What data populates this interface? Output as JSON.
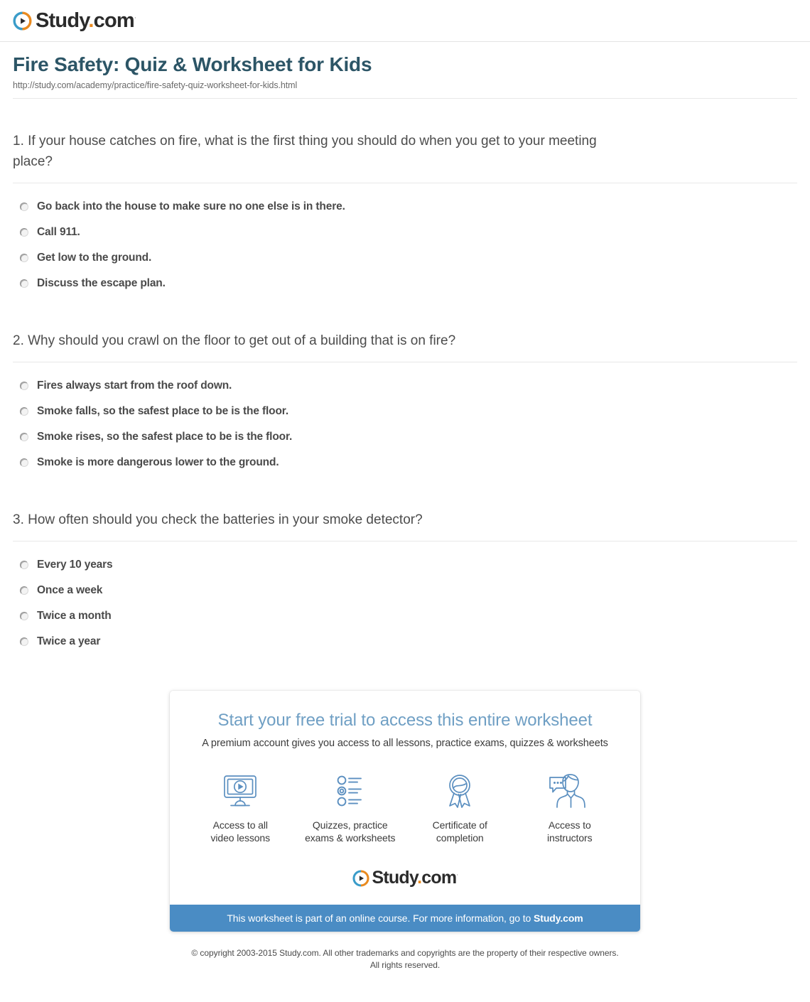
{
  "brand": {
    "name_main": "Study",
    "name_dot": ".",
    "name_tld": "com",
    "trademark": "·",
    "logo_icon": "play-circle-logo-icon",
    "colors": {
      "blue": "#3a9cc9",
      "orange": "#e98a1f",
      "word": "#2b2b2b"
    }
  },
  "header": {
    "title": "Fire Safety: Quiz & Worksheet for Kids",
    "url": "http://study.com/academy/practice/fire-safety-quiz-worksheet-for-kids.html"
  },
  "questions": [
    {
      "text": "1. If your house catches on fire, what is the first thing you should do when you get to your meeting place?",
      "options": [
        "Go back into the house to make sure no one else is in there.",
        "Call 911.",
        "Get low to the ground.",
        "Discuss the escape plan."
      ]
    },
    {
      "text": "2. Why should you crawl on the floor to get out of a building that is on fire?",
      "options": [
        "Fires always start from the roof down.",
        "Smoke falls, so the safest place to be is the floor.",
        "Smoke rises, so the safest place to be is the floor.",
        "Smoke is more dangerous lower to the ground."
      ]
    },
    {
      "text": "3. How often should you check the batteries in your smoke detector?",
      "options": [
        "Every 10 years",
        "Once a week",
        "Twice a month",
        "Twice a year"
      ]
    }
  ],
  "promo": {
    "headline": "Start your free trial to access this entire worksheet",
    "subhead": "A premium account gives you access to all lessons, practice exams, quizzes & worksheets",
    "features": [
      {
        "icon": "monitor-play-icon",
        "label": "Access to all\nvideo lessons",
        "line1": "Access to all",
        "line2": "video lessons"
      },
      {
        "icon": "checklist-icon",
        "label": "Quizzes, practice\nexams & worksheets",
        "line1": "Quizzes, practice",
        "line2": "exams & worksheets"
      },
      {
        "icon": "award-ribbon-icon",
        "label": "Certificate of\ncompletion",
        "line1": "Certificate of",
        "line2": "completion"
      },
      {
        "icon": "instructor-chat-icon",
        "label": "Access to\ninstructors",
        "line1": "Access to",
        "line2": "instructors"
      }
    ],
    "banner_text_before": "This worksheet is part of an online course. For more information, go to ",
    "banner_link": "Study.com",
    "banner_color": "#4a8cc4",
    "headline_color": "#6f9fc4"
  },
  "footer": {
    "line1": "© copyright 2003-2015 Study.com. All other trademarks and copyrights are the property of their respective owners.",
    "line2": "All rights reserved."
  }
}
